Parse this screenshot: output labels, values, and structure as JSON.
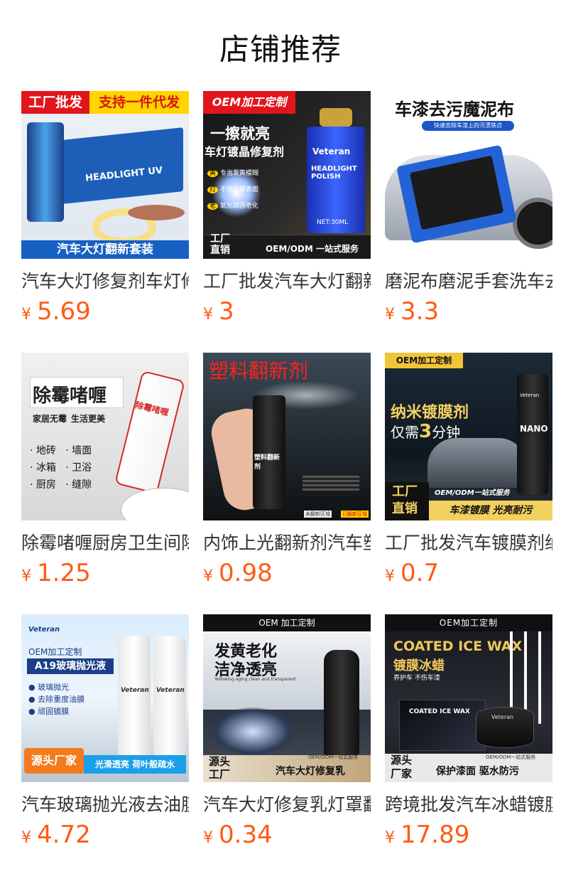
{
  "page": {
    "title": "店铺推荐"
  },
  "currency_symbol": "¥",
  "products": [
    {
      "name": "汽车大灯修复剂车灯修复套装",
      "price": "5.69",
      "image_text": {
        "tag1": "工厂批发",
        "tag2": "支持一件代发",
        "product": "HEADLIGHT UV",
        "bottom": "汽车大灯翻新套装"
      }
    },
    {
      "name": "工厂批发汽车大灯翻新修复剂",
      "price": "3",
      "image_text": {
        "top": "OEM加工定制",
        "line1": "一擦就亮",
        "line2": "车灯镀晶修复剂",
        "brand": "Veteran",
        "label": "HEADLIGHT POLISH",
        "sub": "车灯镀晶修复剂",
        "vol": "NET:30ML",
        "b1": "黄",
        "b1t": "专治发黄模糊",
        "b2": "灯",
        "b2t": "不伤灯罩表面",
        "b3": "老",
        "b3t": "氧化顽固老化",
        "factory1": "工厂",
        "factory2": "直销",
        "service": "OEM/ODM 一站式服务"
      }
    },
    {
      "name": "磨泥布磨泥手套洗车去污",
      "price": "3.3",
      "image_text": {
        "title": "车漆去污魔泥布",
        "sub": "快速去除车漆上的污渍铁点"
      }
    },
    {
      "name": "除霉啫喱厨房卫生间除霉剂",
      "price": "1.25",
      "image_text": {
        "title": "除霉啫喱",
        "sub1": "家居无霉",
        "sub2": "生活更美",
        "i1": "· 地砖",
        "i2": "· 墙面",
        "i3": "· 冰箱",
        "i4": "· 卫浴",
        "i5": "· 厨房",
        "i6": "· 缝隙",
        "tube": "除霉啫喱"
      }
    },
    {
      "name": "内饰上光翻新剂汽车塑料件",
      "price": "0.98",
      "image_text": {
        "title": "塑料翻新剂",
        "bottle": "塑料翻新剂",
        "l1": "未翻新区域",
        "l2": "已翻新区域"
      }
    },
    {
      "name": "工厂批发汽车镀膜剂纳米",
      "price": "0.7",
      "image_text": {
        "top": "OEM加工定制",
        "line1": "纳米镀膜剂",
        "line2a": "仅需",
        "line2b": "3",
        "line2c": "分钟",
        "brand": "Veteran",
        "label": "NANO",
        "f1": "工厂",
        "f2": "直销",
        "service": "OEM/ODM一站式服务",
        "slogan": "车漆镀膜 光亮耐污"
      }
    },
    {
      "name": "汽车玻璃抛光液去油膜",
      "price": "4.72",
      "image_text": {
        "brand": "Veteran",
        "oem": "OEM加工定制",
        "title": "A19玻璃抛光液",
        "p1": "玻璃抛光",
        "p2": "去除重度油膜",
        "p3": "顽固镀膜",
        "bottle": "Veteran",
        "tag": "源头厂家",
        "slogan": "光滑透亮 荷叶般疏水"
      }
    },
    {
      "name": "汽车大灯修复乳灯罩翻新",
      "price": "0.34",
      "image_text": {
        "top": "OEM 加工定制",
        "line1": "发黄老化",
        "line2": "洁净透亮",
        "sub": "Yellowing aging clean and transparent",
        "tag1": "源头",
        "tag2": "工厂",
        "service": "OEM/ODM一站式服务",
        "slogan": "汽车大灯修复乳"
      }
    },
    {
      "name": "跨境批发汽车冰蜡镀膜蜡",
      "price": "17.89",
      "image_text": {
        "top": "OEM加工定制",
        "line1": "COATED ICE WAX",
        "line2": "镀膜冰蜡",
        "sub": "养护车 不伤车漆",
        "box": "COATED ICE WAX",
        "brand": "Veteran",
        "tag1": "源头",
        "tag2": "厂家",
        "service": "OEM/ODM一站式服务",
        "slogan": "保护漆面 驱水防污"
      }
    }
  ]
}
